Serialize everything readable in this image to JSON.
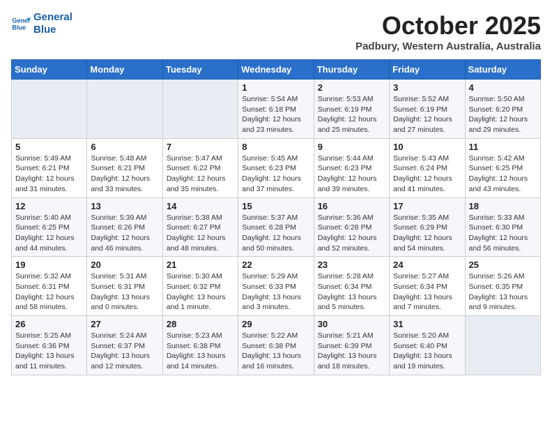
{
  "logo": {
    "line1": "General",
    "line2": "Blue"
  },
  "title": "October 2025",
  "location": "Padbury, Western Australia, Australia",
  "weekdays": [
    "Sunday",
    "Monday",
    "Tuesday",
    "Wednesday",
    "Thursday",
    "Friday",
    "Saturday"
  ],
  "weeks": [
    [
      {
        "day": "",
        "content": ""
      },
      {
        "day": "",
        "content": ""
      },
      {
        "day": "",
        "content": ""
      },
      {
        "day": "1",
        "content": "Sunrise: 5:54 AM\nSunset: 6:18 PM\nDaylight: 12 hours\nand 23 minutes."
      },
      {
        "day": "2",
        "content": "Sunrise: 5:53 AM\nSunset: 6:19 PM\nDaylight: 12 hours\nand 25 minutes."
      },
      {
        "day": "3",
        "content": "Sunrise: 5:52 AM\nSunset: 6:19 PM\nDaylight: 12 hours\nand 27 minutes."
      },
      {
        "day": "4",
        "content": "Sunrise: 5:50 AM\nSunset: 6:20 PM\nDaylight: 12 hours\nand 29 minutes."
      }
    ],
    [
      {
        "day": "5",
        "content": "Sunrise: 5:49 AM\nSunset: 6:21 PM\nDaylight: 12 hours\nand 31 minutes."
      },
      {
        "day": "6",
        "content": "Sunrise: 5:48 AM\nSunset: 6:21 PM\nDaylight: 12 hours\nand 33 minutes."
      },
      {
        "day": "7",
        "content": "Sunrise: 5:47 AM\nSunset: 6:22 PM\nDaylight: 12 hours\nand 35 minutes."
      },
      {
        "day": "8",
        "content": "Sunrise: 5:45 AM\nSunset: 6:23 PM\nDaylight: 12 hours\nand 37 minutes."
      },
      {
        "day": "9",
        "content": "Sunrise: 5:44 AM\nSunset: 6:23 PM\nDaylight: 12 hours\nand 39 minutes."
      },
      {
        "day": "10",
        "content": "Sunrise: 5:43 AM\nSunset: 6:24 PM\nDaylight: 12 hours\nand 41 minutes."
      },
      {
        "day": "11",
        "content": "Sunrise: 5:42 AM\nSunset: 6:25 PM\nDaylight: 12 hours\nand 43 minutes."
      }
    ],
    [
      {
        "day": "12",
        "content": "Sunrise: 5:40 AM\nSunset: 6:25 PM\nDaylight: 12 hours\nand 44 minutes."
      },
      {
        "day": "13",
        "content": "Sunrise: 5:39 AM\nSunset: 6:26 PM\nDaylight: 12 hours\nand 46 minutes."
      },
      {
        "day": "14",
        "content": "Sunrise: 5:38 AM\nSunset: 6:27 PM\nDaylight: 12 hours\nand 48 minutes."
      },
      {
        "day": "15",
        "content": "Sunrise: 5:37 AM\nSunset: 6:28 PM\nDaylight: 12 hours\nand 50 minutes."
      },
      {
        "day": "16",
        "content": "Sunrise: 5:36 AM\nSunset: 6:28 PM\nDaylight: 12 hours\nand 52 minutes."
      },
      {
        "day": "17",
        "content": "Sunrise: 5:35 AM\nSunset: 6:29 PM\nDaylight: 12 hours\nand 54 minutes."
      },
      {
        "day": "18",
        "content": "Sunrise: 5:33 AM\nSunset: 6:30 PM\nDaylight: 12 hours\nand 56 minutes."
      }
    ],
    [
      {
        "day": "19",
        "content": "Sunrise: 5:32 AM\nSunset: 6:31 PM\nDaylight: 12 hours\nand 58 minutes."
      },
      {
        "day": "20",
        "content": "Sunrise: 5:31 AM\nSunset: 6:31 PM\nDaylight: 13 hours\nand 0 minutes."
      },
      {
        "day": "21",
        "content": "Sunrise: 5:30 AM\nSunset: 6:32 PM\nDaylight: 13 hours\nand 1 minute."
      },
      {
        "day": "22",
        "content": "Sunrise: 5:29 AM\nSunset: 6:33 PM\nDaylight: 13 hours\nand 3 minutes."
      },
      {
        "day": "23",
        "content": "Sunrise: 5:28 AM\nSunset: 6:34 PM\nDaylight: 13 hours\nand 5 minutes."
      },
      {
        "day": "24",
        "content": "Sunrise: 5:27 AM\nSunset: 6:34 PM\nDaylight: 13 hours\nand 7 minutes."
      },
      {
        "day": "25",
        "content": "Sunrise: 5:26 AM\nSunset: 6:35 PM\nDaylight: 13 hours\nand 9 minutes."
      }
    ],
    [
      {
        "day": "26",
        "content": "Sunrise: 5:25 AM\nSunset: 6:36 PM\nDaylight: 13 hours\nand 11 minutes."
      },
      {
        "day": "27",
        "content": "Sunrise: 5:24 AM\nSunset: 6:37 PM\nDaylight: 13 hours\nand 12 minutes."
      },
      {
        "day": "28",
        "content": "Sunrise: 5:23 AM\nSunset: 6:38 PM\nDaylight: 13 hours\nand 14 minutes."
      },
      {
        "day": "29",
        "content": "Sunrise: 5:22 AM\nSunset: 6:38 PM\nDaylight: 13 hours\nand 16 minutes."
      },
      {
        "day": "30",
        "content": "Sunrise: 5:21 AM\nSunset: 6:39 PM\nDaylight: 13 hours\nand 18 minutes."
      },
      {
        "day": "31",
        "content": "Sunrise: 5:20 AM\nSunset: 6:40 PM\nDaylight: 13 hours\nand 19 minutes."
      },
      {
        "day": "",
        "content": ""
      }
    ]
  ]
}
